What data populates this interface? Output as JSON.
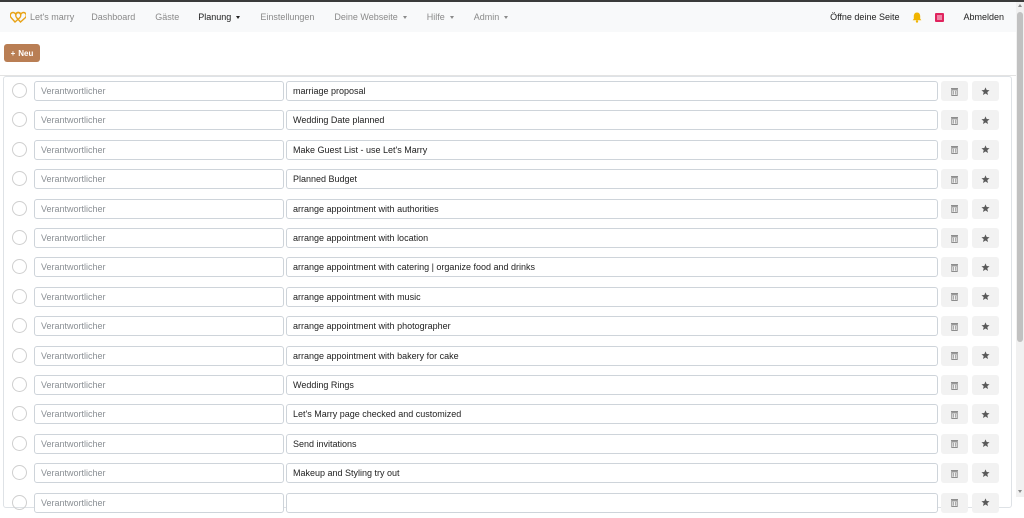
{
  "brand": {
    "name": "Let's marry",
    "icon": "hearts-logo-icon",
    "color": "#e8a317"
  },
  "nav": {
    "items": [
      {
        "label": "Dashboard",
        "dropdown": false,
        "active": false
      },
      {
        "label": "Gäste",
        "dropdown": false,
        "active": false
      },
      {
        "label": "Planung",
        "dropdown": true,
        "active": true
      },
      {
        "label": "Einstellungen",
        "dropdown": false,
        "active": false
      },
      {
        "label": "Deine Webseite",
        "dropdown": true,
        "active": false
      },
      {
        "label": "Hilfe",
        "dropdown": true,
        "active": false
      },
      {
        "label": "Admin",
        "dropdown": true,
        "active": false
      }
    ],
    "open_site": "Öffne deine Seite",
    "bell_icon": "bell-icon",
    "language_icon": "language-flag-icon",
    "logout": "Abmelden"
  },
  "toolbar": {
    "new_label": "Neu",
    "new_icon": "plus-icon",
    "accent": "#b97e54"
  },
  "tasks": {
    "responsible_placeholder": "Verantwortlicher",
    "items": [
      {
        "title": "marriage proposal"
      },
      {
        "title": "Wedding Date planned"
      },
      {
        "title": "Make Guest List - use Let's Marry"
      },
      {
        "title": "Planned Budget"
      },
      {
        "title": "arrange appointment with authorities"
      },
      {
        "title": "arrange appointment with location"
      },
      {
        "title": "arrange appointment with catering | organize food and drinks"
      },
      {
        "title": "arrange appointment with music"
      },
      {
        "title": "arrange appointment with photographer"
      },
      {
        "title": "arrange appointment with bakery for cake"
      },
      {
        "title": "Wedding Rings"
      },
      {
        "title": "Let's Marry page checked and customized"
      },
      {
        "title": "Send invitations"
      },
      {
        "title": "Makeup and Styling try out"
      },
      {
        "title": ""
      }
    ],
    "delete_icon": "trash-icon",
    "star_icon": "star-icon"
  }
}
